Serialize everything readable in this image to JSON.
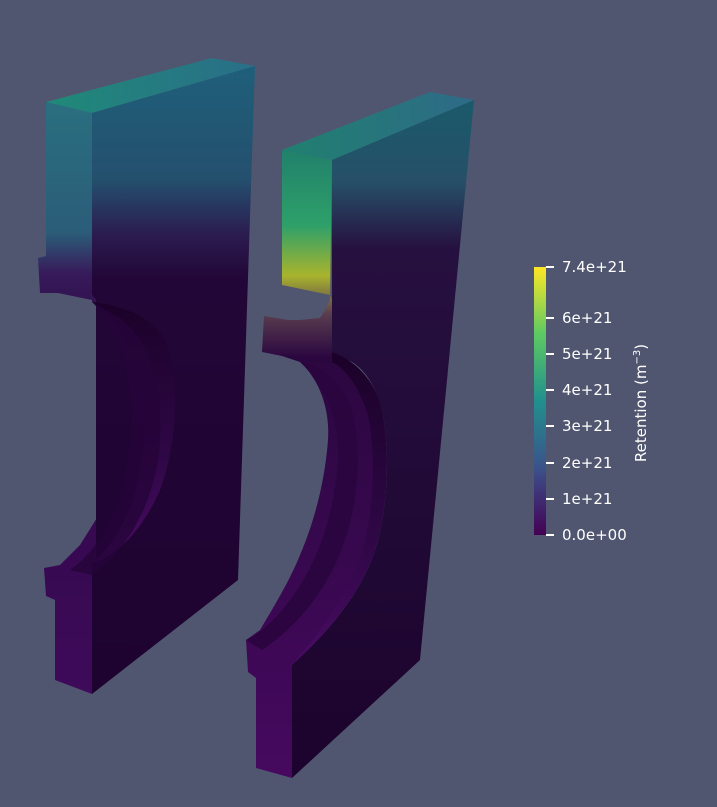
{
  "scene": {
    "background": "#515670",
    "objects": [
      "left-component",
      "right-component"
    ]
  },
  "colorbar": {
    "title": "Retention (m",
    "title_exponent": "−3",
    "title_close": ")",
    "colormap": "viridis",
    "colors": [
      "#440154",
      "#3b528b",
      "#21908d",
      "#5dc963",
      "#fde725"
    ],
    "ticks": [
      {
        "label": "7.4e+21",
        "value": 7.4e+21
      },
      {
        "label": "6e+21",
        "value": 6e+21
      },
      {
        "label": "5e+21",
        "value": 5e+21
      },
      {
        "label": "4e+21",
        "value": 4e+21
      },
      {
        "label": "3e+21",
        "value": 3e+21
      },
      {
        "label": "2e+21",
        "value": 2e+21
      },
      {
        "label": "1e+21",
        "value": 1e+21
      },
      {
        "label": "0.0e+00",
        "value": 0
      }
    ],
    "range": [
      0,
      7.4e+21
    ]
  }
}
